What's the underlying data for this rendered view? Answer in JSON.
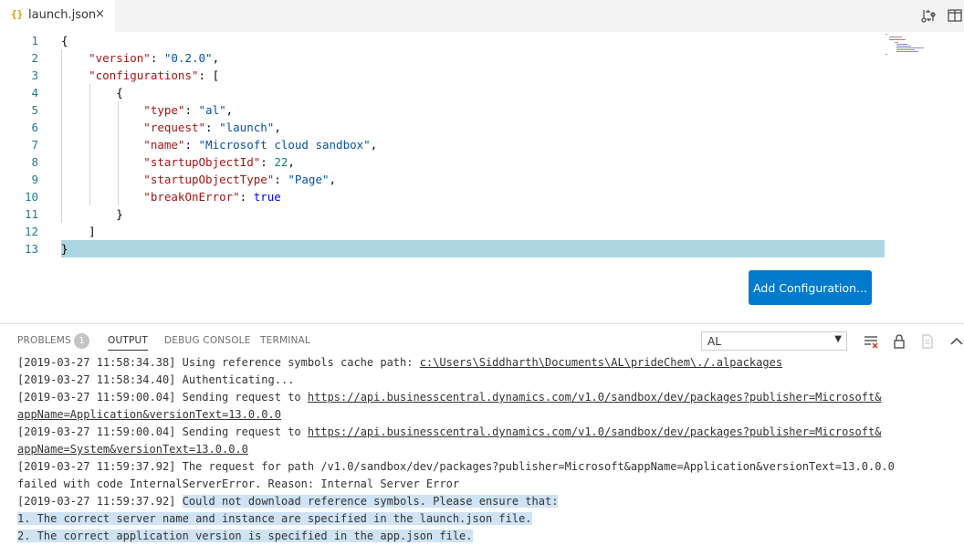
{
  "tab": {
    "icon": "{}",
    "label": "launch.json",
    "close": "×"
  },
  "toolbar": {
    "compare_icon": "compare-changes-icon",
    "split_icon": "split-editor-icon"
  },
  "editor": {
    "line_numbers": [
      "1",
      "2",
      "3",
      "4",
      "5",
      "6",
      "7",
      "8",
      "9",
      "10",
      "11",
      "12",
      "13"
    ],
    "lines": [
      [
        {
          "t": "{",
          "c": "p"
        }
      ],
      [
        {
          "t": "    \"version\"",
          "c": "k"
        },
        {
          "t": ": ",
          "c": "p"
        },
        {
          "t": "\"0.2.0\"",
          "c": "s"
        },
        {
          "t": ",",
          "c": "p"
        }
      ],
      [
        {
          "t": "    \"configurations\"",
          "c": "k"
        },
        {
          "t": ": [",
          "c": "p"
        }
      ],
      [
        {
          "t": "        {",
          "c": "p"
        }
      ],
      [
        {
          "t": "            \"type\"",
          "c": "k"
        },
        {
          "t": ": ",
          "c": "p"
        },
        {
          "t": "\"al\"",
          "c": "s"
        },
        {
          "t": ",",
          "c": "p"
        }
      ],
      [
        {
          "t": "            \"request\"",
          "c": "k"
        },
        {
          "t": ": ",
          "c": "p"
        },
        {
          "t": "\"launch\"",
          "c": "s"
        },
        {
          "t": ",",
          "c": "p"
        }
      ],
      [
        {
          "t": "            \"name\"",
          "c": "k"
        },
        {
          "t": ": ",
          "c": "p"
        },
        {
          "t": "\"Microsoft cloud sandbox\"",
          "c": "s"
        },
        {
          "t": ",",
          "c": "p"
        }
      ],
      [
        {
          "t": "            \"startupObjectId\"",
          "c": "k"
        },
        {
          "t": ": ",
          "c": "p"
        },
        {
          "t": "22",
          "c": "n"
        },
        {
          "t": ",",
          "c": "p"
        }
      ],
      [
        {
          "t": "            \"startupObjectType\"",
          "c": "k"
        },
        {
          "t": ": ",
          "c": "p"
        },
        {
          "t": "\"Page\"",
          "c": "s"
        },
        {
          "t": ",",
          "c": "p"
        }
      ],
      [
        {
          "t": "            \"breakOnError\"",
          "c": "k"
        },
        {
          "t": ": ",
          "c": "p"
        },
        {
          "t": "true",
          "c": "kw"
        }
      ],
      [
        {
          "t": "        }",
          "c": "p"
        }
      ],
      [
        {
          "t": "    ]",
          "c": "p"
        }
      ],
      [
        {
          "t": "}",
          "c": "p"
        }
      ]
    ],
    "add_config_label": "Add Configuration..."
  },
  "panel": {
    "tabs": {
      "problems": "PROBLEMS",
      "problems_count": "1",
      "output": "OUTPUT",
      "debug": "DEBUG CONSOLE",
      "terminal": "TERMINAL"
    },
    "channel": "AL",
    "action_icons": [
      "clear-output-icon",
      "lock-scroll-icon",
      "open-log-icon",
      "collapse-panel-icon"
    ],
    "output_lines": [
      [
        {
          "t": "[2019-03-27 11:58:34.38] Using reference symbols cache path: ",
          "c": ""
        },
        {
          "t": "c:\\Users\\Siddharth\\Documents\\AL\\prideChem\\./.alpackages",
          "c": "link"
        }
      ],
      [
        {
          "t": "[2019-03-27 11:58:34.40] Authenticating...",
          "c": ""
        }
      ],
      [
        {
          "t": "[2019-03-27 11:59:00.04] Sending request to ",
          "c": ""
        },
        {
          "t": "https://api.businesscentral.dynamics.com/v1.0/sandbox/dev/packages?publisher=Microsoft&",
          "c": "link"
        }
      ],
      [
        {
          "t": "appName=Application&versionText=13.0.0.0",
          "c": "link"
        }
      ],
      [
        {
          "t": "[2019-03-27 11:59:00.04] Sending request to ",
          "c": ""
        },
        {
          "t": "https://api.businesscentral.dynamics.com/v1.0/sandbox/dev/packages?publisher=Microsoft&",
          "c": "link"
        }
      ],
      [
        {
          "t": "appName=System&versionText=13.0.0.0",
          "c": "link"
        }
      ],
      [
        {
          "t": "[2019-03-27 11:59:37.92] The request for path /v1.0/sandbox/dev/packages?publisher=Microsoft&appName=Application&versionText=13.0.0.0",
          "c": ""
        }
      ],
      [
        {
          "t": "failed with code InternalServerError. Reason: Internal Server Error",
          "c": ""
        }
      ],
      [
        {
          "t": "[2019-03-27 11:59:37.92] ",
          "c": ""
        },
        {
          "t": "Could not download reference symbols. Please ensure that:",
          "c": "hl"
        }
      ],
      [
        {
          "t": "1. The correct server name and instance are specified in the launch.json file.",
          "c": "hl"
        }
      ],
      [
        {
          "t": "2. The correct application version is specified in the app.json file.",
          "c": "hl"
        }
      ]
    ]
  }
}
